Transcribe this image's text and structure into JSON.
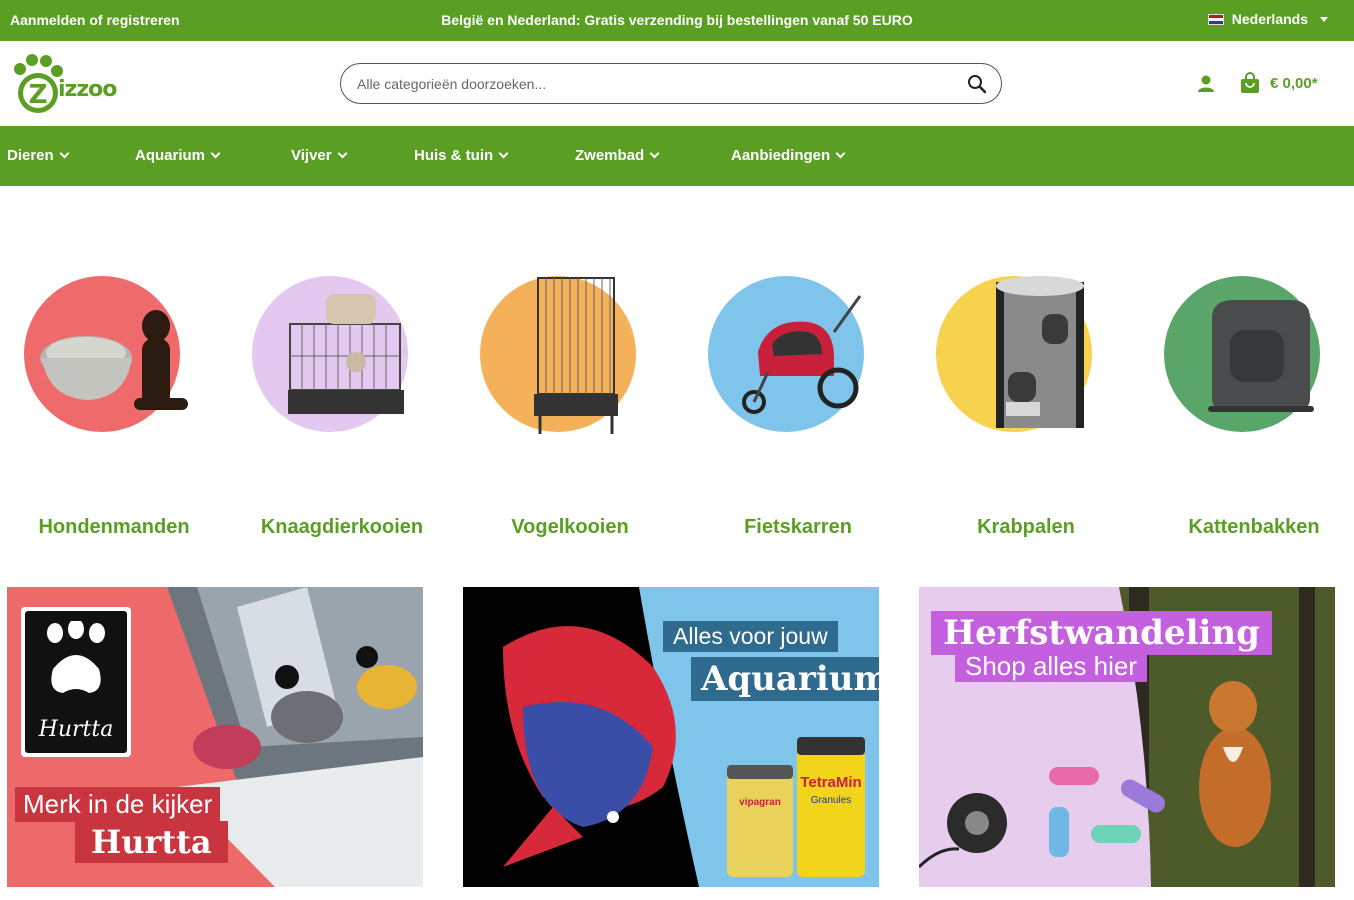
{
  "topbar": {
    "login_label": "Aanmelden of registreren",
    "promo_text": "België en Nederland: Gratis verzending bij bestellingen vanaf 50 EURO",
    "language_label": "Nederlands"
  },
  "header": {
    "logo_text": "izzoo",
    "search_placeholder": "Alle categorieën doorzoeken...",
    "cart_total": "€ 0,00*"
  },
  "nav": {
    "items": [
      {
        "label": "Dieren"
      },
      {
        "label": "Aquarium"
      },
      {
        "label": "Vijver"
      },
      {
        "label": "Huis & tuin"
      },
      {
        "label": "Zwembad"
      },
      {
        "label": "Aanbiedingen"
      }
    ]
  },
  "categories": [
    {
      "label": "Hondenmanden",
      "color": "#ef6b6b"
    },
    {
      "label": "Knaagdierkooien",
      "color": "#e3c8ef"
    },
    {
      "label": "Vogelkooien",
      "color": "#f5b05a"
    },
    {
      "label": "Fietskarren",
      "color": "#7fc4ea"
    },
    {
      "label": "Krabpalen",
      "color": "#f7d24f"
    },
    {
      "label": "Kattenbakken",
      "color": "#5aa66a"
    }
  ],
  "banners": {
    "hurtta": {
      "brand_logo_text": "Hurtta",
      "line1": "Merk in de kijker",
      "line2": "Hurtta",
      "color": "#ee6a6a"
    },
    "aquarium": {
      "line1": "Alles voor jouw",
      "line2": "Aquarium",
      "product1_text": "vipagran",
      "product2_text": "TetraMin",
      "product2_sub": "Granules",
      "color": "#7fc4ea"
    },
    "herfst": {
      "line1": "Herfstwandeling",
      "line2": "Shop alles hier",
      "color": "#c45fe0"
    }
  }
}
